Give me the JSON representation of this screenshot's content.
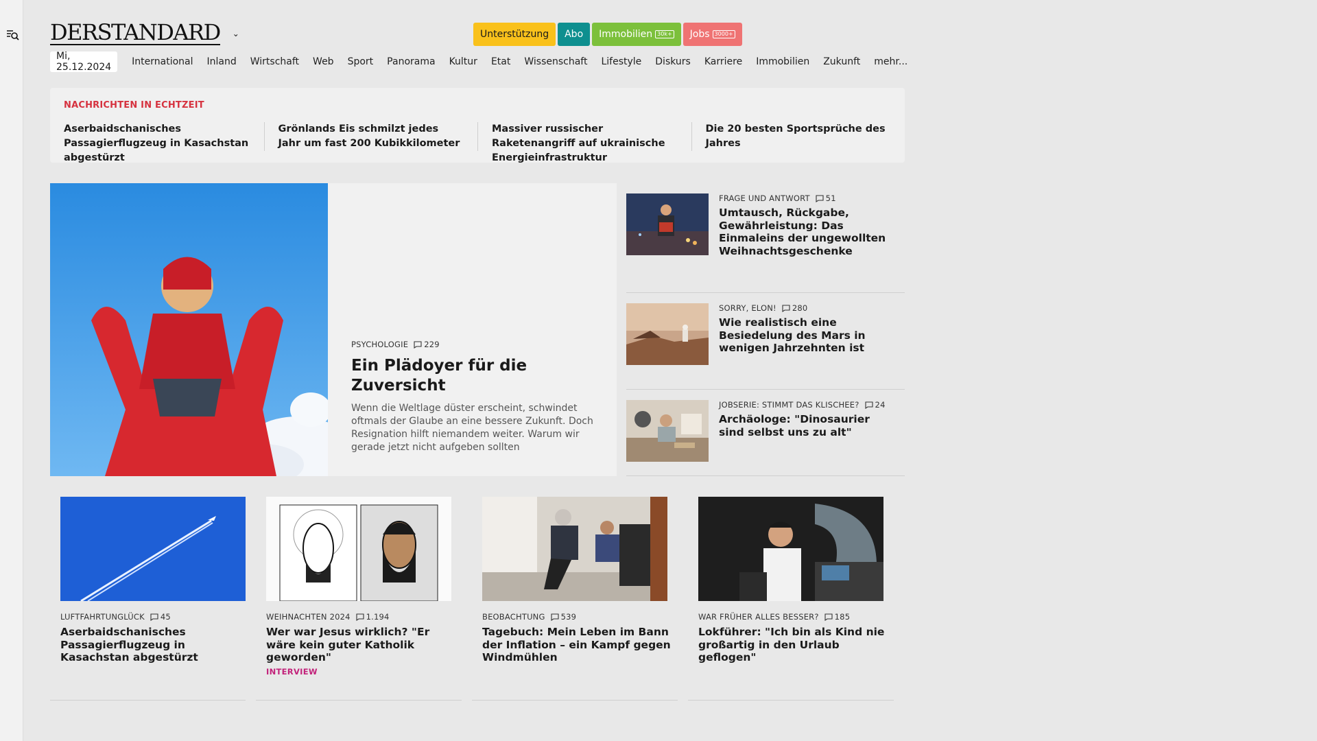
{
  "brand": {
    "logo_text": "DERSTANDARD"
  },
  "pills": {
    "support": "Unterstützung",
    "abo": "Abo",
    "immo": "Immobilien",
    "immo_tag": "30k+",
    "jobs": "Jobs",
    "jobs_tag": "3000+"
  },
  "nav": {
    "date": "Mi, 25.12.2024",
    "items": [
      "International",
      "Inland",
      "Wirtschaft",
      "Web",
      "Sport",
      "Panorama",
      "Kultur",
      "Etat",
      "Wissenschaft",
      "Lifestyle",
      "Diskurs",
      "Karriere",
      "Immobilien",
      "Zukunft",
      "mehr..."
    ]
  },
  "ticker": {
    "title": "NACHRICHTEN IN ECHTZEIT",
    "items": [
      "Aserbaidschanisches Passagierflug­zeug in Kasachstan abgestürzt",
      "Grönlands Eis schmilzt jedes Jahr um fast 200 Kubikkilometer",
      "Massiver russischer Raketenangriff auf ukrainische Energieinfrastruktur",
      "Die 20 besten Sportsprüche des Jahres"
    ]
  },
  "lead": {
    "kicker": "PSYCHOLOGIE",
    "comments": "229",
    "title": "Ein Plädoyer für die Zuversicht",
    "teaser": "Wenn die Weltlage düster erscheint, schwindet oftmals der Glaube an eine bessere Zukunft. Doch Resignation hilft niemandem weiter. Warum wir gerade jetzt nicht aufgeben sollten"
  },
  "side": [
    {
      "kicker": "FRAGE UND ANTWORT",
      "comments": "51",
      "title": "Umtausch, Rückgabe, Gewähr­leistung: Das Einmaleins der ungewollten Weihnachtsge­schenke"
    },
    {
      "kicker": "SORRY, ELON!",
      "comments": "280",
      "title": "Wie realistisch eine Besiedelung des Mars in wenigen Jahrzehnten ist"
    },
    {
      "kicker": "JOBSERIE: STIMMT DAS KLISCHEE?",
      "comments": "24",
      "title": "Archäologe: \"Dinosaurier sind selbst uns zu alt\""
    }
  ],
  "cards": [
    {
      "kicker": "LUFTFAHRTUNGLÜCK",
      "comments": "45",
      "title": "Aserbaidschanisches Passagier­flugzeug in Kasachstan abgestürzt",
      "label": ""
    },
    {
      "kicker": "WEIHNACHTEN 2024",
      "comments": "1.194",
      "title": "Wer war Jesus wirklich? \"Er wäre kein guter Katholik geworden\"",
      "label": "INTERVIEW"
    },
    {
      "kicker": "BEOBACHTUNG",
      "comments": "539",
      "title": "Tagebuch: Mein Leben im Bann der Inflation – ein Kampf gegen Windmühlen",
      "label": ""
    },
    {
      "kicker": "WAR FRÜHER ALLES BESSER?",
      "comments": "185",
      "title": "Lokführer: \"Ich bin als Kind nie großartig in den Urlaub geflogen\"",
      "label": ""
    }
  ],
  "colors": {
    "ticker_title": "#d6323f",
    "support": "#f9c11b",
    "abo": "#0e8f8f",
    "immo": "#7cc03b",
    "jobs": "#ef7373",
    "interview": "#c2227a"
  }
}
